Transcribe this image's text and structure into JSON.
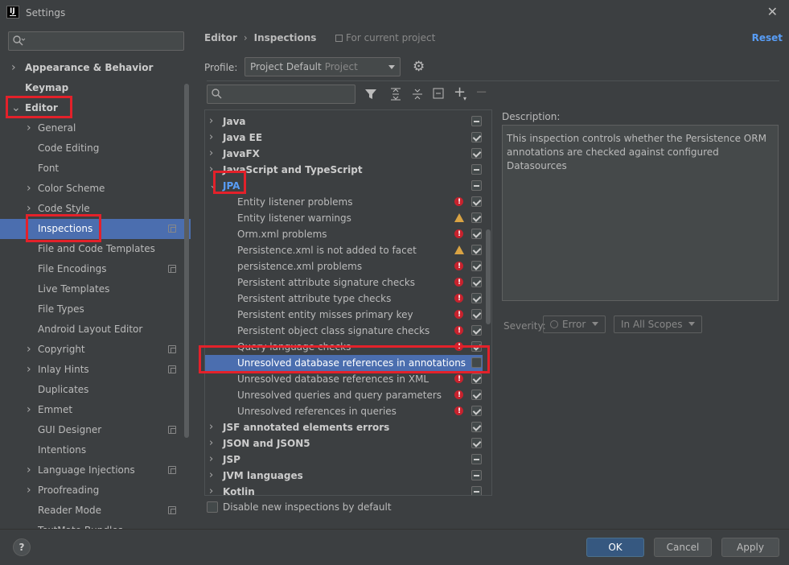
{
  "window": {
    "title": "Settings",
    "icon": "intellij-icon",
    "icon_text": "IJ"
  },
  "sidebar": {
    "search_placeholder": "",
    "items": [
      {
        "label": "Appearance & Behavior",
        "level": 0,
        "chevron": ">",
        "bold": true
      },
      {
        "label": "Keymap",
        "level": 0,
        "bold": true
      },
      {
        "label": "Editor",
        "level": 0,
        "chevron": "v",
        "bold": true
      },
      {
        "label": "General",
        "level": 1,
        "chevron": ">"
      },
      {
        "label": "Code Editing",
        "level": 1
      },
      {
        "label": "Font",
        "level": 1
      },
      {
        "label": "Color Scheme",
        "level": 1,
        "chevron": ">"
      },
      {
        "label": "Code Style",
        "level": 1,
        "chevron": ">"
      },
      {
        "label": "Inspections",
        "level": 1,
        "selected": true,
        "project": true
      },
      {
        "label": "File and Code Templates",
        "level": 1
      },
      {
        "label": "File Encodings",
        "level": 1,
        "project": true
      },
      {
        "label": "Live Templates",
        "level": 1
      },
      {
        "label": "File Types",
        "level": 1
      },
      {
        "label": "Android Layout Editor",
        "level": 1
      },
      {
        "label": "Copyright",
        "level": 1,
        "chevron": ">",
        "project": true
      },
      {
        "label": "Inlay Hints",
        "level": 1,
        "chevron": ">",
        "project": true
      },
      {
        "label": "Duplicates",
        "level": 1
      },
      {
        "label": "Emmet",
        "level": 1,
        "chevron": ">"
      },
      {
        "label": "GUI Designer",
        "level": 1,
        "project": true
      },
      {
        "label": "Intentions",
        "level": 1
      },
      {
        "label": "Language Injections",
        "level": 1,
        "chevron": ">",
        "project": true
      },
      {
        "label": "Proofreading",
        "level": 1,
        "chevron": ">"
      },
      {
        "label": "Reader Mode",
        "level": 1,
        "project": true
      },
      {
        "label": "TextMate Bundles",
        "level": 1
      }
    ]
  },
  "header": {
    "breadcrumb": [
      "Editor",
      "Inspections"
    ],
    "scope_note": "For current project",
    "reset": "Reset"
  },
  "profile": {
    "label": "Profile:",
    "value": "Project Default",
    "sub": "Project"
  },
  "toolbar": {
    "filter": "filter-icon",
    "expand": "expand-all-icon",
    "collapse": "collapse-all-icon",
    "reset": "reset-icon",
    "add": "+",
    "remove": "−"
  },
  "inspections": [
    {
      "label": "Java",
      "group": true,
      "state": "dash"
    },
    {
      "label": "Java EE",
      "group": true,
      "state": "on"
    },
    {
      "label": "JavaFX",
      "group": true,
      "state": "on"
    },
    {
      "label": "JavaScript and TypeScript",
      "group": true,
      "state": "dash"
    },
    {
      "label": "JPA",
      "group": true,
      "expanded": true,
      "state": "dash",
      "highlight": true
    },
    {
      "label": "Entity listener problems",
      "severity": "error",
      "state": "on"
    },
    {
      "label": "Entity listener warnings",
      "severity": "warning",
      "state": "on"
    },
    {
      "label": "Orm.xml problems",
      "severity": "error",
      "state": "on"
    },
    {
      "label": "Persistence.xml is not added to facet",
      "severity": "warning",
      "state": "on"
    },
    {
      "label": "persistence.xml problems",
      "severity": "error",
      "state": "on"
    },
    {
      "label": "Persistent attribute signature checks",
      "severity": "error",
      "state": "on"
    },
    {
      "label": "Persistent attribute type checks",
      "severity": "error",
      "state": "on"
    },
    {
      "label": "Persistent entity misses primary key",
      "severity": "error",
      "state": "on"
    },
    {
      "label": "Persistent object class signature checks",
      "severity": "error",
      "state": "on"
    },
    {
      "label": "Query language checks",
      "severity": "error",
      "state": "on"
    },
    {
      "label": "Unresolved database references in annotations",
      "state": "off",
      "selected": true
    },
    {
      "label": "Unresolved database references in XML",
      "severity": "error",
      "state": "on"
    },
    {
      "label": "Unresolved queries and query parameters",
      "severity": "error",
      "state": "on"
    },
    {
      "label": "Unresolved references in queries",
      "severity": "error",
      "state": "on"
    },
    {
      "label": "JSF annotated elements errors",
      "group": true,
      "state": "on"
    },
    {
      "label": "JSON and JSON5",
      "group": true,
      "state": "on"
    },
    {
      "label": "JSP",
      "group": true,
      "state": "dash"
    },
    {
      "label": "JVM languages",
      "group": true,
      "state": "dash"
    },
    {
      "label": "Kotlin",
      "group": true,
      "state": "dash"
    }
  ],
  "disable_new": "Disable new inspections by default",
  "description": {
    "label": "Description:",
    "text": "This inspection controls whether the Persistence ORM annotations are checked against configured Datasources"
  },
  "severity": {
    "label": "Severity:",
    "value": "Error",
    "scope": "In All Scopes"
  },
  "footer": {
    "help": "?",
    "ok": "OK",
    "cancel": "Cancel",
    "apply": "Apply"
  },
  "colors": {
    "highlight": "#e3212a",
    "selection": "#4b6eaf",
    "link": "#589df6",
    "error": "#c7222d",
    "warning": "#d9a343"
  }
}
